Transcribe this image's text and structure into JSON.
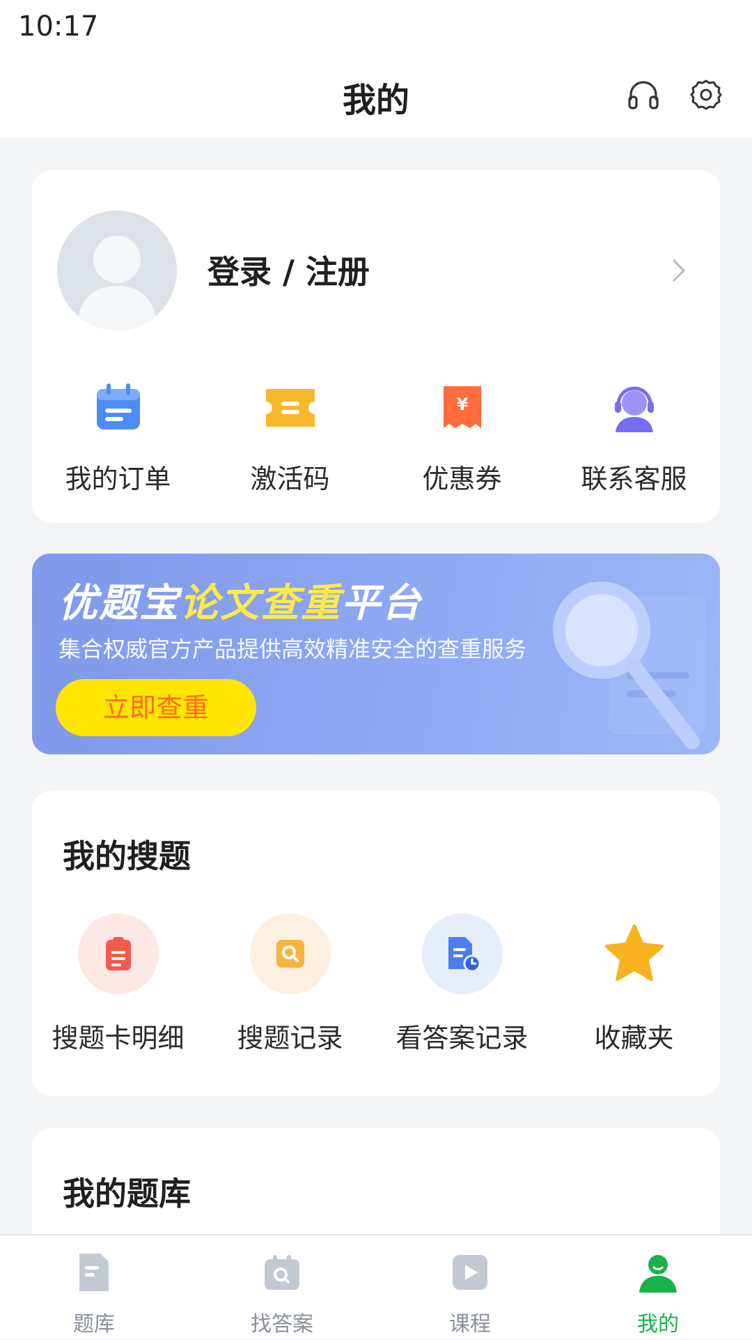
{
  "status_bar": {
    "time": "10:17"
  },
  "header": {
    "title": "我的",
    "icons": [
      "headset-icon",
      "gear-icon"
    ]
  },
  "profile": {
    "login_label": "登录 / 注册",
    "quick_actions": [
      {
        "label": "我的订单",
        "icon": "calendar-icon",
        "color": "#4d8cf5"
      },
      {
        "label": "激活码",
        "icon": "ticket-icon",
        "color": "#f7b72a"
      },
      {
        "label": "优惠券",
        "icon": "coupon-icon",
        "color": "#ff6b3a"
      },
      {
        "label": "联系客服",
        "icon": "service-agent-icon",
        "color": "#7a6cf0"
      }
    ]
  },
  "banner": {
    "title_part1": "优题宝",
    "title_highlight": "论文查重",
    "title_part2": "平台",
    "subtitle": "集合权威官方产品提供高效精准安全的查重服务",
    "button_label": "立即查重"
  },
  "my_search": {
    "title": "我的搜题",
    "items": [
      {
        "label": "搜题卡明细",
        "icon": "clipboard-icon",
        "bg": "#fde8e6",
        "fg": "#f15b4e"
      },
      {
        "label": "搜题记录",
        "icon": "search-icon",
        "bg": "#fdf0e0",
        "fg": "#f5b43b"
      },
      {
        "label": "看答案记录",
        "icon": "document-clock-icon",
        "bg": "#e6eefc",
        "fg": "#4b7ff0"
      },
      {
        "label": "收藏夹",
        "icon": "star-icon",
        "bg": "#ffffff",
        "fg": "#f8b21e"
      }
    ]
  },
  "my_bank": {
    "title": "我的题库"
  },
  "bottom_nav": {
    "items": [
      {
        "label": "题库",
        "icon": "document-icon",
        "active": false
      },
      {
        "label": "找答案",
        "icon": "camera-search-icon",
        "active": false
      },
      {
        "label": "课程",
        "icon": "play-icon",
        "active": false
      },
      {
        "label": "我的",
        "icon": "user-icon",
        "active": true
      }
    ],
    "active_color": "#18b24a",
    "inactive_color": "#c3c9d3"
  }
}
